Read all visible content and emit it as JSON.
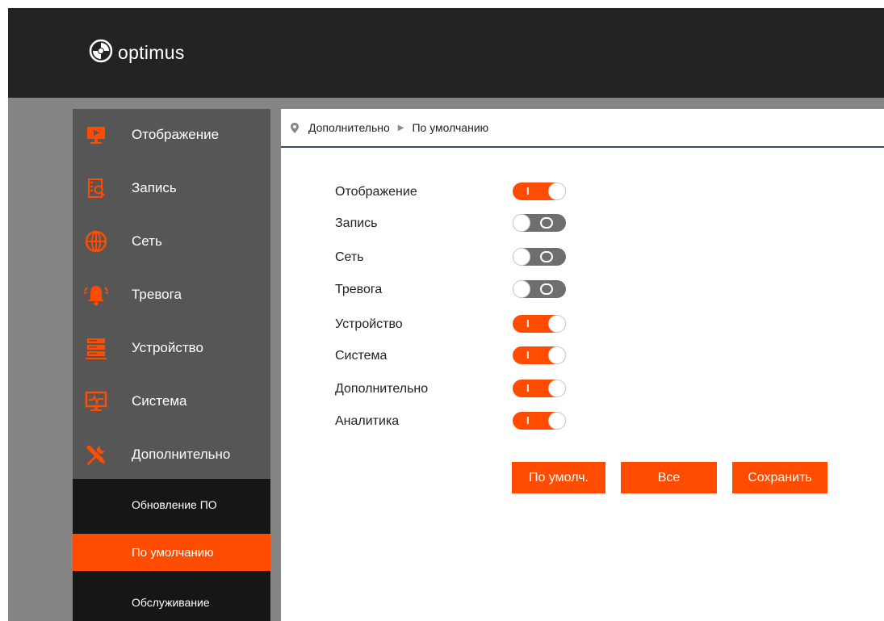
{
  "app": {
    "logo_text": "optimus"
  },
  "breadcrumb": {
    "level1": "Дополнительно",
    "level2": "По умолчанию"
  },
  "sidebar": {
    "items": [
      {
        "label": "Отображение",
        "icon": "display-icon"
      },
      {
        "label": "Запись",
        "icon": "record-search-icon"
      },
      {
        "label": "Сеть",
        "icon": "globe-icon"
      },
      {
        "label": "Тревога",
        "icon": "alarm-bell-icon"
      },
      {
        "label": "Устройство",
        "icon": "server-icon"
      },
      {
        "label": "Система",
        "icon": "monitor-pulse-icon"
      },
      {
        "label": "Дополнительно",
        "icon": "tools-icon"
      }
    ],
    "subitems": [
      {
        "label": "Обновление ПО",
        "active": false
      },
      {
        "label": "По умолчанию",
        "active": true
      },
      {
        "label": "Обслуживание",
        "active": false
      }
    ]
  },
  "settings": [
    {
      "label": "Отображение",
      "on": true
    },
    {
      "label": "Запись",
      "on": false
    },
    {
      "label": "Сеть",
      "on": false
    },
    {
      "label": "Тревога",
      "on": false
    },
    {
      "label": "Устройство",
      "on": true
    },
    {
      "label": "Система",
      "on": true
    },
    {
      "label": "Дополнительно",
      "on": true
    },
    {
      "label": "Аналитика",
      "on": true
    }
  ],
  "toggle_marks": {
    "on": "I",
    "off": ""
  },
  "buttons": {
    "default": "По умолч.",
    "all": "Все",
    "save": "Сохранить"
  },
  "colors": {
    "accent": "#ff4c00",
    "sidebar": "#565656",
    "topbar": "#232323",
    "toggle_off": "#6e6e6e"
  }
}
